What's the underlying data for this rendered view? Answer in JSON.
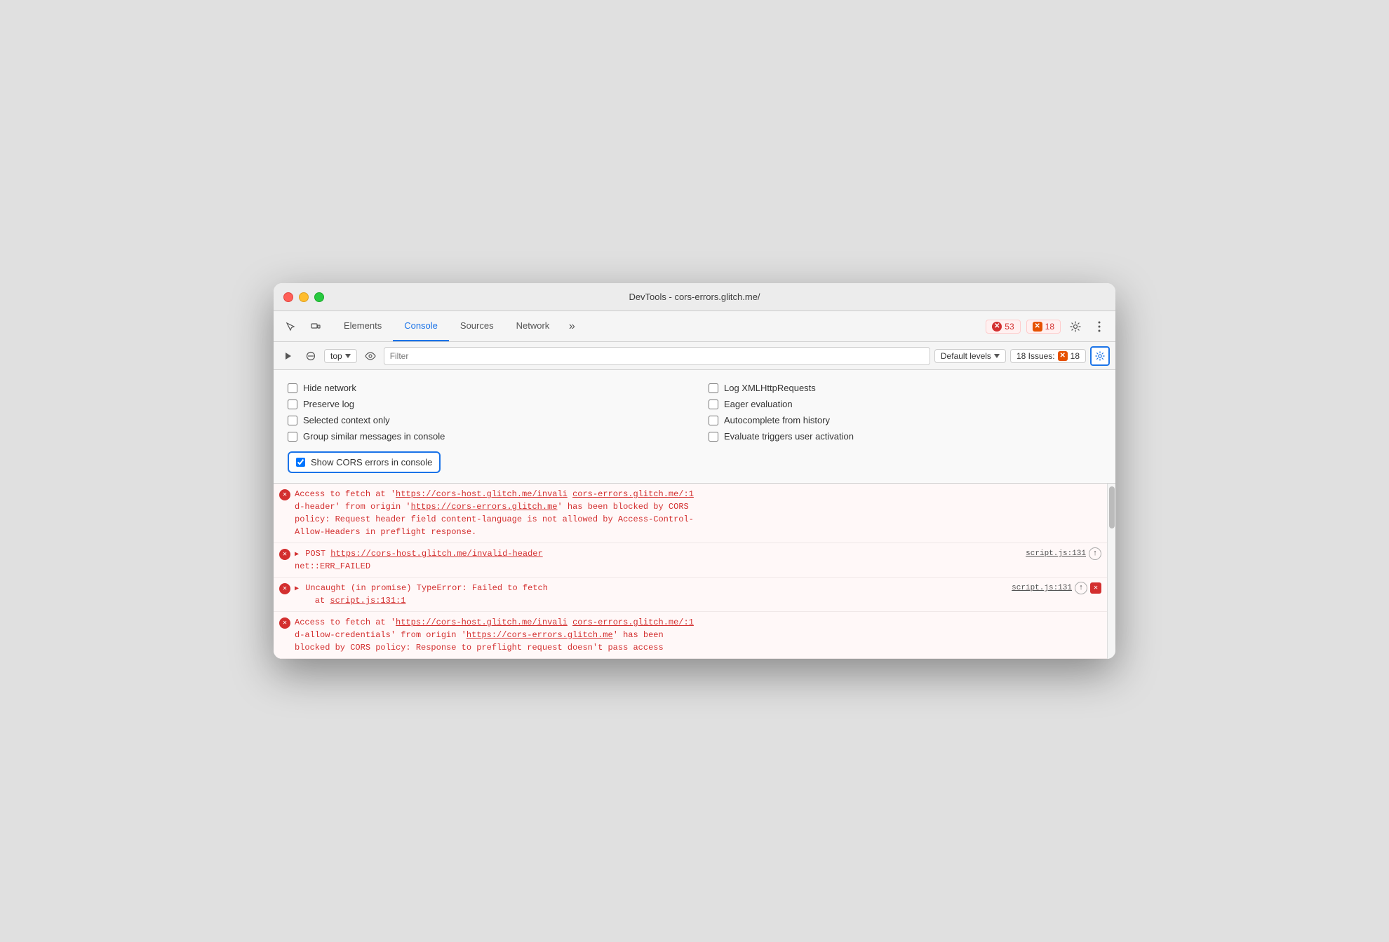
{
  "window": {
    "title": "DevTools - cors-errors.glitch.me/"
  },
  "tabs": [
    {
      "label": "Elements",
      "active": false
    },
    {
      "label": "Console",
      "active": true
    },
    {
      "label": "Sources",
      "active": false
    },
    {
      "label": "Network",
      "active": false
    }
  ],
  "toolbar": {
    "more_tabs": "»",
    "error_count": "53",
    "warning_count": "18",
    "gear_title": "Settings",
    "more_title": "More options"
  },
  "console_toolbar": {
    "top_label": "top",
    "filter_placeholder": "Filter",
    "levels_label": "Default levels",
    "issues_label": "18 Issues:",
    "issues_count": "18"
  },
  "settings": {
    "checkboxes_left": [
      {
        "label": "Hide network",
        "checked": false
      },
      {
        "label": "Preserve log",
        "checked": false
      },
      {
        "label": "Selected context only",
        "checked": false
      },
      {
        "label": "Group similar messages in console",
        "checked": false
      }
    ],
    "checkboxes_right": [
      {
        "label": "Log XMLHttpRequests",
        "checked": false
      },
      {
        "label": "Eager evaluation",
        "checked": false
      },
      {
        "label": "Autocomplete from history",
        "checked": false
      },
      {
        "label": "Evaluate triggers user activation",
        "checked": false
      }
    ],
    "cors_label": "Show CORS errors in console",
    "cors_checked": true
  },
  "console_entries": [
    {
      "id": 1,
      "type": "error",
      "has_right": false,
      "lines": [
        "Access to fetch at 'https://cors-host.glitch.me/invali cors-errors.glitch.me/:1",
        "d-header' from origin 'https://cors-errors.glitch.me' has been blocked by CORS",
        "policy: Request header field content-language is not allowed by Access-Control-",
        "Allow-Headers in preflight response."
      ],
      "link1": "https://cors-host.glitch.me/invali",
      "link2": "cors-errors.glitch.me/:1"
    },
    {
      "id": 2,
      "type": "error",
      "has_right": true,
      "source": "script.js:131",
      "has_upload": true,
      "has_close": false,
      "content": "▶POST https://cors-host.glitch.me/invalid-header",
      "content2": "net::ERR_FAILED",
      "link": "https://cors-host.glitch.me/invalid-header"
    },
    {
      "id": 3,
      "type": "error",
      "has_right": true,
      "source": "script.js:131",
      "has_upload": true,
      "has_close": true,
      "content": "▶Uncaught (in promise) TypeError: Failed to fetch",
      "content2": "at script.js:131:1",
      "link": "script.js:131:1"
    },
    {
      "id": 4,
      "type": "error",
      "has_right": false,
      "lines": [
        "Access to fetch at 'https://cors-host.glitch.me/invali cors-errors.glitch.me/:1",
        "d-allow-credentials' from origin 'https://cors-errors.glitch.me' has been",
        "blocked by CORS policy: Response to preflight request doesn't pass access"
      ],
      "link1": "https://cors-host.glitch.me/invali",
      "link2": "cors-errors.glitch.me/:1"
    }
  ]
}
